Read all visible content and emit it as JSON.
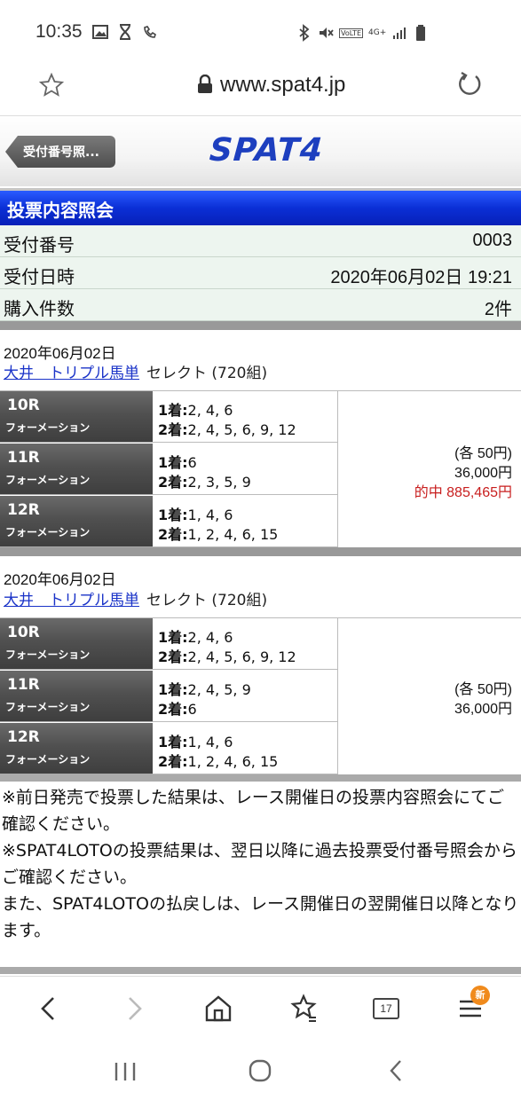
{
  "status_bar": {
    "time": "10:35",
    "network": "4G+",
    "volte": "VoLTE"
  },
  "browser": {
    "url": "www.spat4.jp",
    "tab_count": "17",
    "menu_badge": "新"
  },
  "header": {
    "back_label": "受付番号照...",
    "logo": "SPAT4"
  },
  "page_title": "投票内容照会",
  "info": [
    {
      "label": "受付番号",
      "value": "0003"
    },
    {
      "label": "受付日時",
      "value": "2020年06月02日 19:21"
    },
    {
      "label": "購入件数",
      "value": "2件"
    }
  ],
  "tickets": [
    {
      "date": "2020年06月02日",
      "race_link": "大井　トリプル馬単",
      "select_text": "セレクト (720組)",
      "legs": [
        {
          "race": "10R",
          "type": "フォーメーション",
          "first": "2, 4, 6",
          "second": "2, 4, 5, 6, 9, 12"
        },
        {
          "race": "11R",
          "type": "フォーメーション",
          "first": "6",
          "second": "2, 3, 5, 9"
        },
        {
          "race": "12R",
          "type": "フォーメーション",
          "first": "1, 4, 6",
          "second": "1, 2, 4, 6, 15"
        }
      ],
      "unit": "(各 50円)",
      "total": "36,000円",
      "hit": "的中 885,465円"
    },
    {
      "date": "2020年06月02日",
      "race_link": "大井　トリプル馬単",
      "select_text": "セレクト (720組)",
      "legs": [
        {
          "race": "10R",
          "type": "フォーメーション",
          "first": "2, 4, 6",
          "second": "2, 4, 5, 6, 9, 12"
        },
        {
          "race": "11R",
          "type": "フォーメーション",
          "first": "2, 4, 5, 9",
          "second": "6"
        },
        {
          "race": "12R",
          "type": "フォーメーション",
          "first": "1, 4, 6",
          "second": "1, 2, 4, 6, 15"
        }
      ],
      "unit": "(各 50円)",
      "total": "36,000円",
      "hit": ""
    }
  ],
  "labels": {
    "first": "1着:",
    "second": "2着:"
  },
  "notes": [
    "※前日発売で投票した結果は、レース開催日の投票内容照会にてご確認ください。",
    "※SPAT4LOTOの投票結果は、翌日以降に過去投票受付番号照会からご確認ください。",
    "また、SPAT4LOTOの払戻しは、レース開催日の翌開催日以降となります。"
  ]
}
